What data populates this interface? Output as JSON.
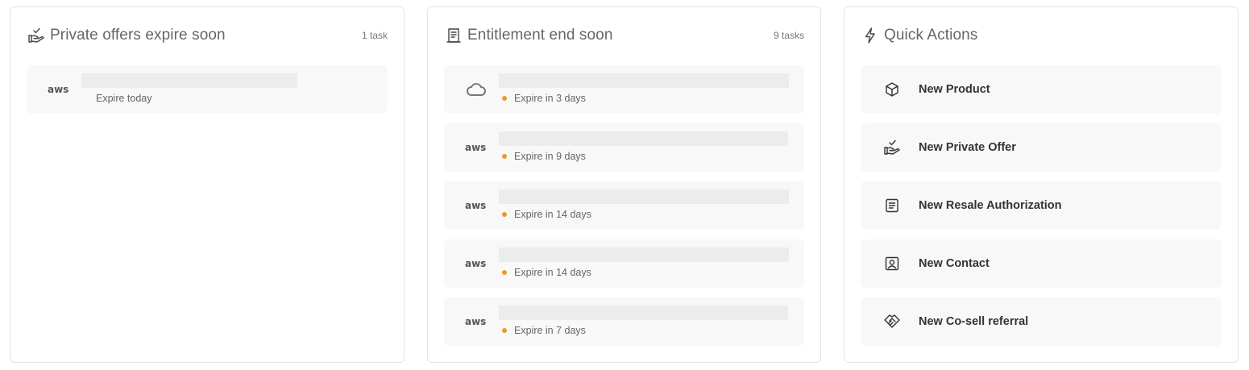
{
  "offers_card": {
    "title": "Private offers expire soon",
    "count": "1 task",
    "icon": "hand-check-icon",
    "items": [
      {
        "logo": "aws",
        "logo_text": "aws",
        "status": "Expire today",
        "has_dot": false
      }
    ]
  },
  "entitlements_card": {
    "title": "Entitlement end soon",
    "count": "9 tasks",
    "icon": "receipt-icon",
    "items": [
      {
        "logo": "cloud",
        "status": "Expire in 3 days",
        "has_dot": true
      },
      {
        "logo": "aws",
        "logo_text": "aws",
        "status": "Expire in 9 days",
        "has_dot": true
      },
      {
        "logo": "aws",
        "logo_text": "aws",
        "status": "Expire in 14 days",
        "has_dot": true
      },
      {
        "logo": "aws",
        "logo_text": "aws",
        "status": "Expire in 14 days",
        "has_dot": true
      },
      {
        "logo": "aws",
        "logo_text": "aws",
        "status": "Expire in 7 days",
        "has_dot": true
      }
    ]
  },
  "actions_card": {
    "title": "Quick Actions",
    "icon": "lightning-icon",
    "items": [
      {
        "label": "New Product",
        "icon": "cube-icon"
      },
      {
        "label": "New Private Offer",
        "icon": "hand-check-icon"
      },
      {
        "label": "New Resale Authorization",
        "icon": "document-icon"
      },
      {
        "label": "New Contact",
        "icon": "contact-card-icon"
      },
      {
        "label": "New Co-sell referral",
        "icon": "handshake-icon"
      }
    ]
  },
  "colors": {
    "status_dot": "#e89a2b",
    "row_bg": "#f8f8f8",
    "placeholder_bar": "#ececec"
  }
}
